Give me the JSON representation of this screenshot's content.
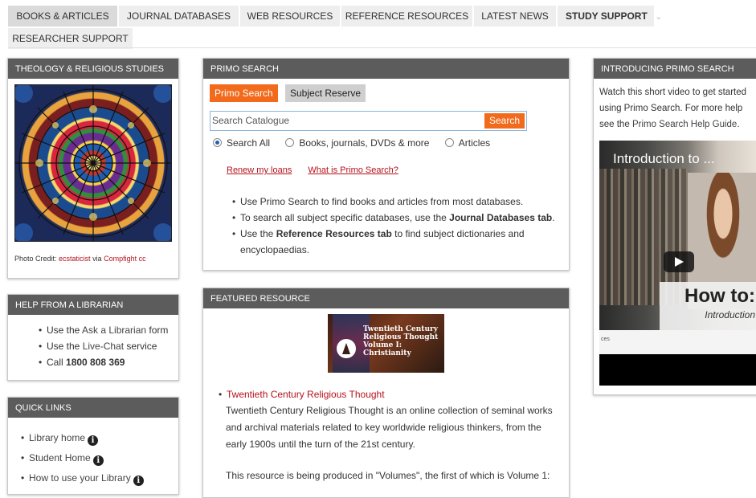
{
  "nav": {
    "tabs": [
      "BOOKS & ARTICLES",
      "JOURNAL DATABASES",
      "WEB RESOURCES",
      "REFERENCE RESOURCES",
      "LATEST NEWS",
      "STUDY SUPPORT"
    ],
    "tab_row2": "RESEARCHER SUPPORT",
    "study_support_caret": "⌄"
  },
  "theology": {
    "title": "THEOLOGY & RELIGIOUS STUDIES",
    "credit_prefix": "Photo Credit:",
    "credit_author": "ecstaticist",
    "credit_via": "via",
    "credit_source": "Compfight cc"
  },
  "help": {
    "title": "HELP FROM A LIBRARIAN",
    "item1_prefix": "Use the",
    "item1_link": "Ask a Librarian",
    "item1_suffix": "form",
    "item2_prefix": "Use the",
    "item2_link": "Live-Chat",
    "item2_suffix": "service",
    "item3_prefix": "Call",
    "item3_phone": "1800 808 369"
  },
  "quicklinks": {
    "title": "QUICK LINKS",
    "items": [
      "Library home",
      "Student Home",
      "How to use your Library"
    ]
  },
  "primo": {
    "title": "PRIMO SEARCH",
    "tab_active": "Primo Search",
    "tab_other": "Subject Reserve",
    "placeholder": "Search Catalogue",
    "search_button": "Search",
    "radio_all": "Search All",
    "radio_books": "Books, journals, DVDs & more",
    "radio_articles": "Articles",
    "link_renew": "Renew my loans",
    "link_what": "What is Primo Search?",
    "tip1": "Use Primo Search to find books and articles from most databases.",
    "tip2_prefix": "To search all subject specific databases, use the",
    "tip2_bold": "Journal Databases tab",
    "tip2_suffix": ".",
    "tip3_prefix": "Use the",
    "tip3_bold": "Reference Resources tab",
    "tip3_suffix": "to find subject dictionaries and encyclopaedias."
  },
  "featured": {
    "title": "FEATURED RESOURCE",
    "book_title": "Twentieth Century Religious Thought Volume I: Christianity",
    "link": "Twentieth Century Religious Thought",
    "desc": "Twentieth Century Religious Thought is an online collection of seminal works and archival materials related to key worldwide religious thinkers, from the early 1900s until the turn of the 21st century.",
    "desc2": "This resource is being produced in \"Volumes\", the first of which is Volume 1:"
  },
  "intro": {
    "title": "INTRODUCING PRIMO SEARCH",
    "text_prefix": "Watch this short video to get started using Primo Search. For more help see the",
    "link": "Primo Search Help Guide",
    "text_suffix": ".",
    "video_title": "Introduction to ...",
    "video_howto": "How to:",
    "video_sub": "Introduction",
    "video_small": "ces"
  },
  "colors": {
    "accent_orange": "#f26a1b",
    "link_red": "#b5121b",
    "panel_header": "#5c5c5c"
  }
}
